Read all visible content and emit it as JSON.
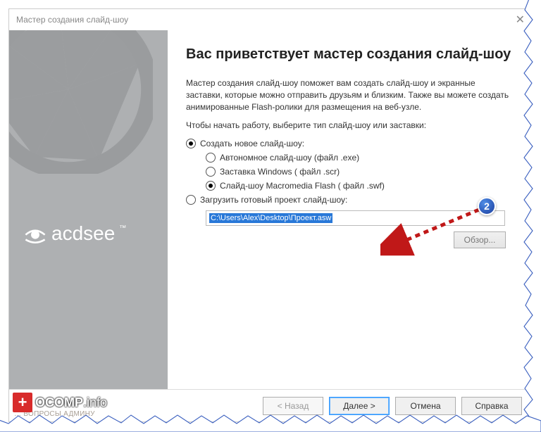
{
  "window": {
    "title": "Мастер создания слайд-шоу"
  },
  "sidebar": {
    "brand": "acdsee"
  },
  "heading": "Вас приветствует мастер создания слайд-шоу",
  "intro1": "Мастер создания слайд-шоу поможет вам создать слайд-шоу и экранные заставки, которые можно отправить друзьям и близким. Также вы можете создать анимированные Flash-ролики для размещения на веб-узле.",
  "intro2": "Чтобы начать работу, выберите тип слайд-шоу или заставки:",
  "opt_main_create": "Создать новое слайд-шоу:",
  "opt_exe": "Автономное слайд-шоу (файл .exe)",
  "opt_scr": "Заставка Windows ( файл .scr)",
  "opt_swf": "Слайд-шоу Macromedia Flash ( файл .swf)",
  "opt_main_load": "Загрузить готовый проект слайд-шоу:",
  "path_value": "C:\\Users\\Alex\\Desktop\\Проект.asw",
  "browse_label": "Обзор...",
  "footer": {
    "back": "< Назад",
    "next": "Далее >",
    "cancel": "Отмена",
    "help": "Справка"
  },
  "annotation": {
    "badge": "2"
  },
  "ocomp": {
    "text": "OCOMP",
    "suffix": ".info"
  },
  "watermark": "… ВОПРОСЫ АДМИНУ"
}
